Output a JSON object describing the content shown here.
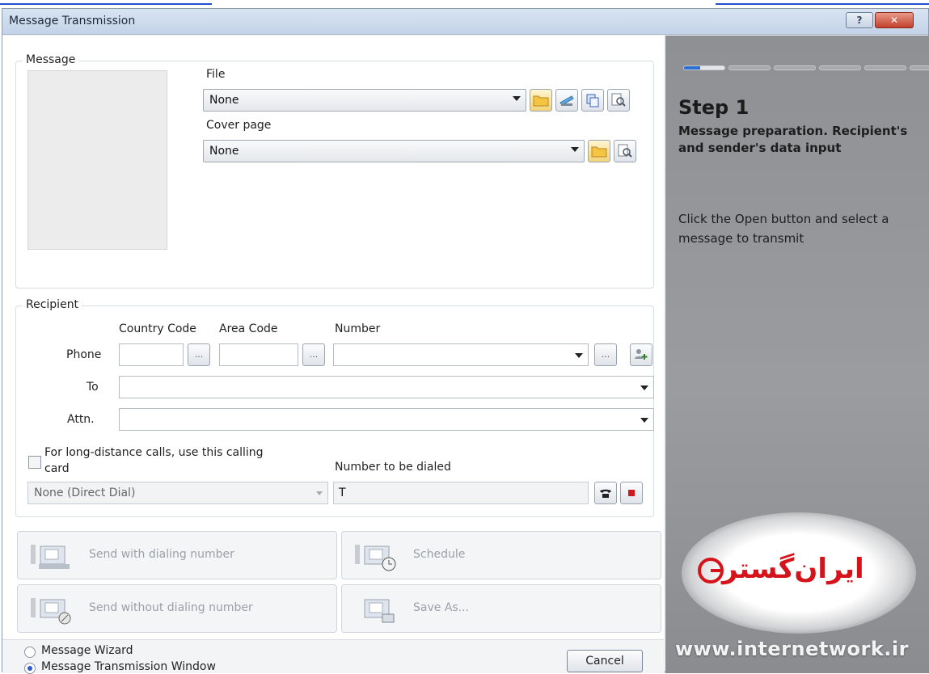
{
  "window": {
    "title": "Message Transmission",
    "help_label": "?",
    "close_label": "✕"
  },
  "message": {
    "group_title": "Message",
    "file_label": "File",
    "file_value": "None",
    "cover_label": "Cover page",
    "cover_value": "None"
  },
  "recipient": {
    "group_title": "Recipient",
    "country_code_label": "Country Code",
    "area_code_label": "Area Code",
    "number_label": "Number",
    "phone_label": "Phone",
    "to_label": "To",
    "attn_label": "Attn.",
    "browse_label": "...",
    "calling_card_label_line1": "For long-distance calls, use this calling",
    "calling_card_label_line2": "card",
    "calling_card_value": "None (Direct Dial)",
    "number_to_dial_label": "Number to be dialed",
    "number_to_dial_value": "T"
  },
  "actions": {
    "send_with_dialing": "Send with dialing number",
    "schedule": "Schedule",
    "send_without_dialing": "Send without dialing number",
    "save_as": "Save As..."
  },
  "footer": {
    "message_wizard": "Message Wizard",
    "transmission_window": "Message Transmission Window",
    "cancel": "Cancel"
  },
  "side": {
    "step_title": "Step 1",
    "step_subtitle": "Message preparation. Recipient's and sender's data input",
    "step_hint": "Click the Open button and select a message to transmit",
    "progress_current_step": 1,
    "progress_total_steps": 6,
    "logo_text": "ایران‌گستر",
    "website": "www.internetwork.ir"
  },
  "colors": {
    "accent": "#2c6fd6",
    "side_panel": "#9a9ca0",
    "logo_red": "#d4141a"
  }
}
